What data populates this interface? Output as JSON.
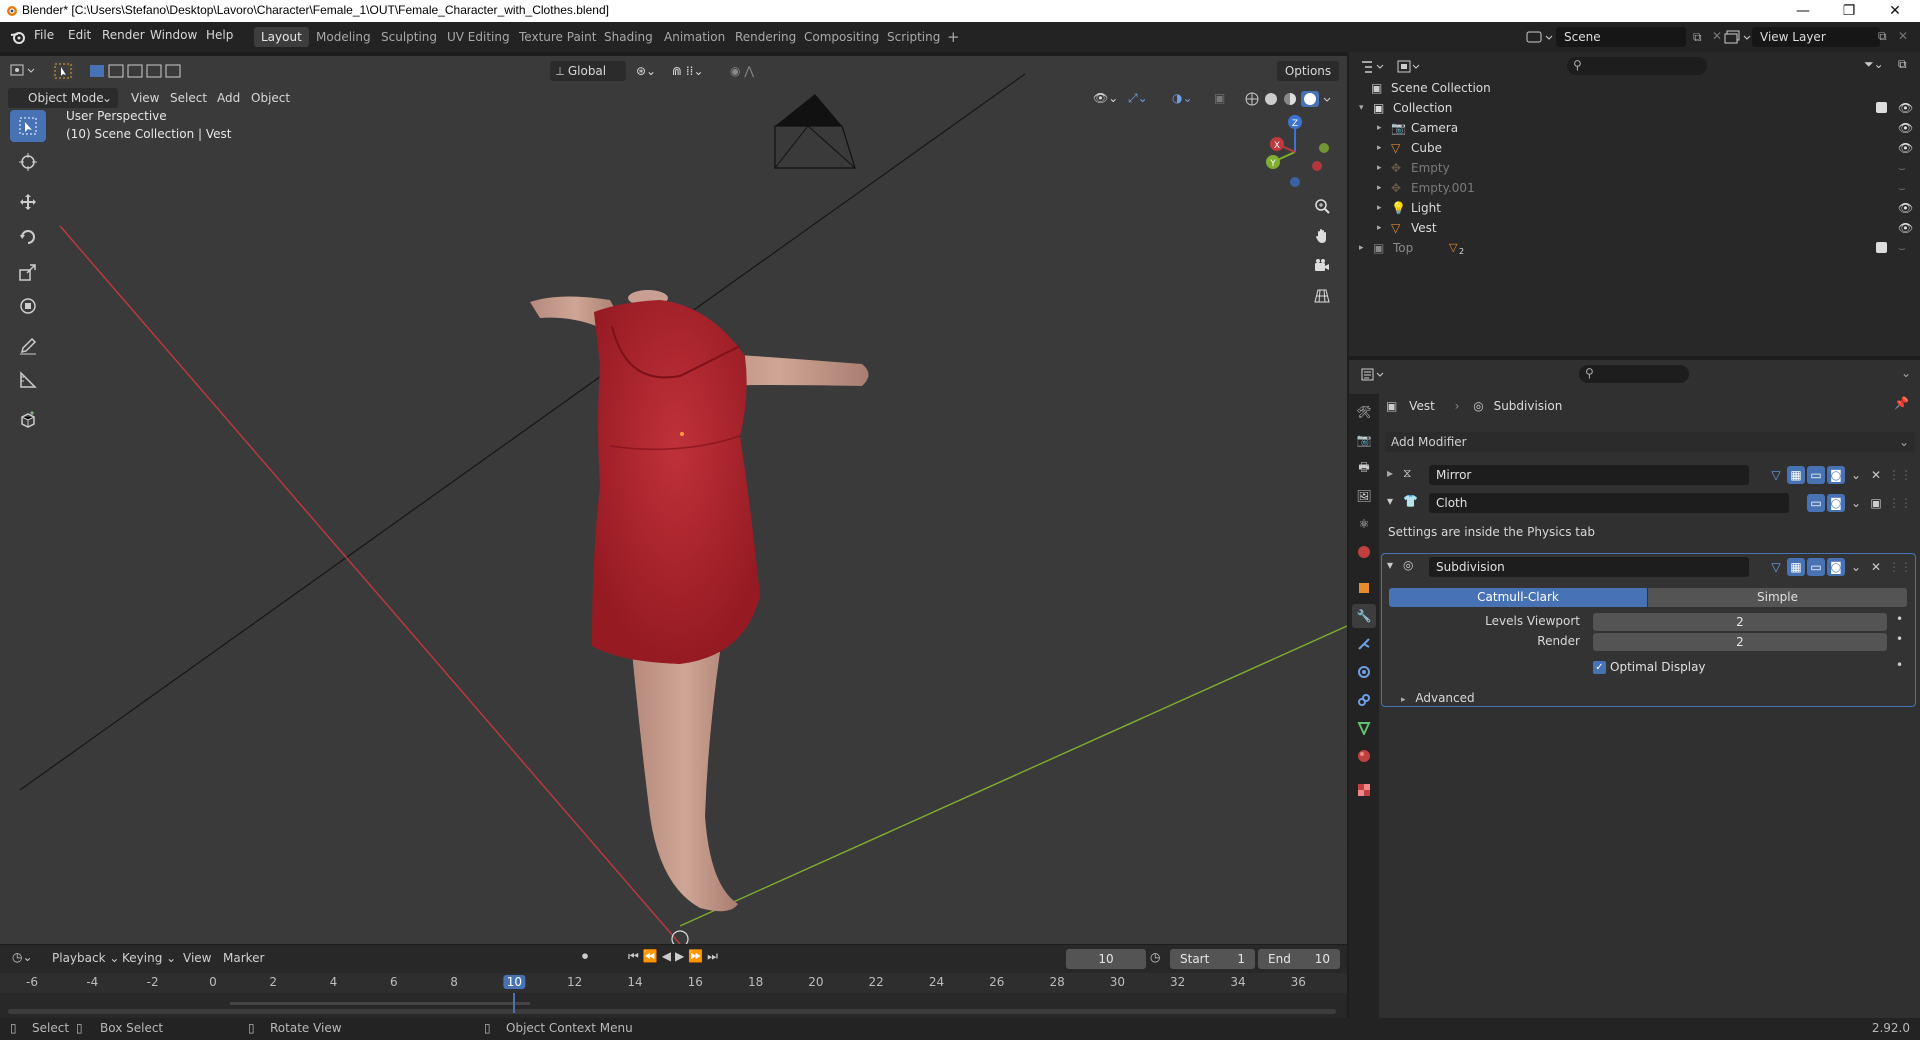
{
  "window": {
    "title": "Blender* [C:\\Users\\Stefano\\Desktop\\Lavoro\\Character\\Female_1\\OUT\\Female_Character_with_Clothes.blend]",
    "minimize": "—",
    "restore": "❐",
    "close": "✕"
  },
  "menu": [
    "File",
    "Edit",
    "Render",
    "Window",
    "Help"
  ],
  "workspaces": [
    "Layout",
    "Modeling",
    "Sculpting",
    "UV Editing",
    "Texture Paint",
    "Shading",
    "Animation",
    "Rendering",
    "Compositing",
    "Scripting"
  ],
  "workspace_active": "Layout",
  "scene": {
    "name": "Scene",
    "view_layer": "View Layer"
  },
  "viewport": {
    "mode": "Object Mode",
    "menus": [
      "View",
      "Select",
      "Add",
      "Object"
    ],
    "orientation": "Global",
    "options_label": "Options",
    "perspective_label": "User Perspective",
    "collection_label": "(10) Scene Collection | Vest",
    "gizmo": {
      "x": "X",
      "y": "Y",
      "z": "Z"
    },
    "colors": {
      "bg": "#3a3a3a",
      "x_axis": "#c0393f",
      "y_axis": "#7fae31",
      "dress": "#b0222a",
      "skin": "#c79b8c"
    }
  },
  "outliner": {
    "root": "Scene Collection",
    "items": [
      {
        "name": "Collection",
        "level": 1,
        "visible": true
      },
      {
        "name": "Camera",
        "level": 2,
        "visible": true
      },
      {
        "name": "Cube",
        "level": 2,
        "visible": true
      },
      {
        "name": "Empty",
        "level": 2,
        "visible": false
      },
      {
        "name": "Empty.001",
        "level": 2,
        "visible": false
      },
      {
        "name": "Light",
        "level": 2,
        "visible": true
      },
      {
        "name": "Vest",
        "level": 2,
        "visible": true
      },
      {
        "name": "Top",
        "level": 1,
        "visible": false
      }
    ],
    "top_badge": "2"
  },
  "properties": {
    "breadcrumb_object": "Vest",
    "breadcrumb_modifier": "Subdivision",
    "add_modifier": "Add Modifier",
    "modifiers": [
      {
        "name": "Mirror",
        "expanded": false
      },
      {
        "name": "Cloth",
        "expanded": true,
        "note": "Settings are inside the Physics tab"
      },
      {
        "name": "Subdivision",
        "expanded": true
      }
    ],
    "subdivision": {
      "type_options": [
        "Catmull-Clark",
        "Simple"
      ],
      "type_selected": "Catmull-Clark",
      "levels_viewport_label": "Levels Viewport",
      "levels_viewport": "2",
      "render_label": "Render",
      "render": "2",
      "optimal_display_label": "Optimal Display",
      "optimal_display": true,
      "advanced_label": "Advanced"
    }
  },
  "timeline": {
    "menus": [
      "Playback",
      "Keying",
      "View",
      "Marker"
    ],
    "current_frame": "10",
    "start_label": "Start",
    "start": "1",
    "end_label": "End",
    "end": "10",
    "ruler": [
      "-6",
      "-4",
      "-2",
      "0",
      "2",
      "4",
      "6",
      "8",
      "10",
      "12",
      "14",
      "16",
      "18",
      "20",
      "22",
      "24",
      "26",
      "28",
      "30",
      "32",
      "34",
      "36"
    ]
  },
  "status": {
    "select": "Select",
    "box_select": "Box Select",
    "rotate": "Rotate View",
    "context": "Object Context Menu",
    "version": "2.92.0"
  }
}
